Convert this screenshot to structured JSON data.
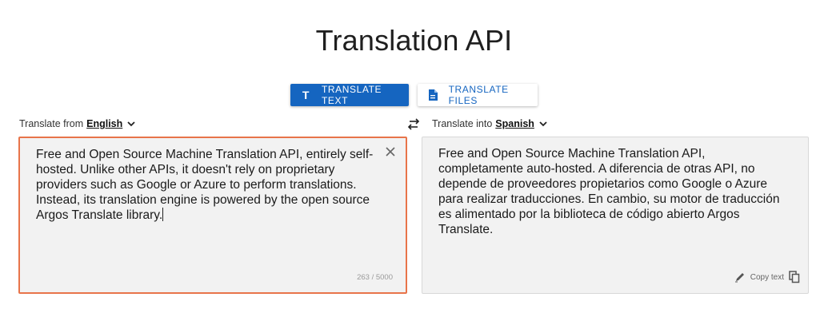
{
  "page": {
    "title": "Translation API"
  },
  "modes": {
    "translate_text": "TRANSLATE TEXT",
    "translate_files": "TRANSLATE FILES",
    "text_icon": "T"
  },
  "source": {
    "label": "Translate from",
    "language": "English",
    "text": "Free and Open Source Machine Translation API, entirely self-hosted. Unlike other APIs, it doesn't rely on proprietary providers such as Google or Azure to perform translations. Instead, its translation engine is powered by the open source Argos Translate library.",
    "char_count": "263 / 5000"
  },
  "target": {
    "label": "Translate into",
    "language": "Spanish",
    "text": "Free and Open Source Machine Translation API, completamente auto-hosted. A diferencia de otras API, no depende de proveedores propietarios como Google o Azure para realizar traducciones. En cambio, su motor de traducción es alimentado por la biblioteca de código abierto Argos Translate.",
    "copy_label": "Copy text"
  },
  "icons": {
    "text_mode": "text-format-icon",
    "file_mode": "file-document-icon",
    "chevron": "chevron-down-icon",
    "swap": "swap-horizontal-icon",
    "clear": "close-icon",
    "edit": "pencil-icon",
    "copy": "copy-icon"
  },
  "colors": {
    "accent": "#1565c0",
    "source_border": "#e8744a",
    "pane_bg": "#f2f2f2"
  }
}
